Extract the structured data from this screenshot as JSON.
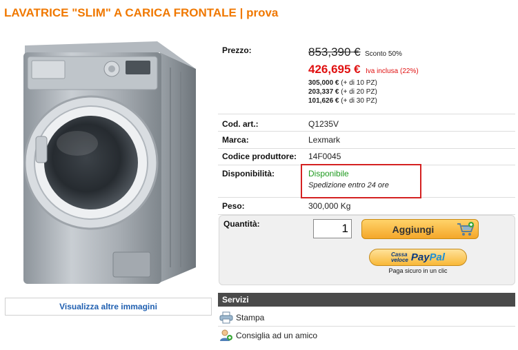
{
  "product": {
    "title": "LAVATRICE \"SLIM\" A CARICA FRONTALE | prova",
    "more_images_label": "Visualizza altre immagini"
  },
  "details": {
    "price_label": "Prezzo:",
    "old_price": "853,390 €",
    "discount": "Sconto 50%",
    "new_price": "426,695 €",
    "vat_note": "Iva inclusa (22%)",
    "tiers": [
      {
        "price": "305,000 €",
        "note": "(+ di 10 PZ)"
      },
      {
        "price": "203,337 €",
        "note": "(+ di 20 PZ)"
      },
      {
        "price": "101,626 €",
        "note": "(+ di 30 PZ)"
      }
    ],
    "code_label": "Cod. art.:",
    "code": "Q1235V",
    "brand_label": "Marca:",
    "brand": "Lexmark",
    "mfr_code_label": "Codice produttore:",
    "mfr_code": "14F0045",
    "availability_label": "Disponibilità:",
    "availability": "Disponibile",
    "shipping": "Spedizione entro 24 ore",
    "weight_label": "Peso:",
    "weight": "300,000 Kg"
  },
  "purchase": {
    "qty_label": "Quantità:",
    "qty_value": "1",
    "add_button": "Aggiungi",
    "paypal_small_1": "Cassa",
    "paypal_small_2": "veloce",
    "paypal_pay": "Pay",
    "paypal_pal": "Pal",
    "paypal_subtitle": "Paga sicuro in un clic"
  },
  "services": {
    "header": "Servizi",
    "items": [
      {
        "label": "Stampa",
        "icon": "printer-icon"
      },
      {
        "label": "Consiglia ad un amico",
        "icon": "user-recommend-icon"
      }
    ]
  },
  "colors": {
    "title": "#f07800",
    "price": "#e01010",
    "available": "#1e9a1e",
    "highlight": "#d42020"
  }
}
